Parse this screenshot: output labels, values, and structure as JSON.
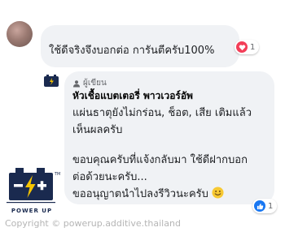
{
  "comment": {
    "text": "ใช้ดีจริงจึงบอกต่อ การันตีครับ100%",
    "reaction_count": "1"
  },
  "reply": {
    "badge_label": "ผู้เขียน",
    "author": "หัวเชื้อแบตเตอรี่ พาวเวอร์อัพ",
    "lines": [
      "แผ่นธาตุยังไม่กร่อน, ช็อต, เสีย เติมแล้ว",
      "เห็นผลครับ",
      "ขอบคุณครับที่แจ้งกลับมา ใช้ดีฝากบอก",
      "ต่อด้วยนะครับ...",
      "ขออนุญาตนำไปลงรีวิวนะครับ"
    ],
    "reaction_count": "1"
  },
  "logo": {
    "text": "POWER UP",
    "mark": "TM"
  },
  "watermark": "Copyright © powerup.additive.thailand",
  "colors": {
    "bubble": "#f0f2f5",
    "heart": "#f33e58",
    "like": "#1877f2",
    "logo_navy": "#1a2a4f",
    "logo_yellow": "#f5c400"
  }
}
